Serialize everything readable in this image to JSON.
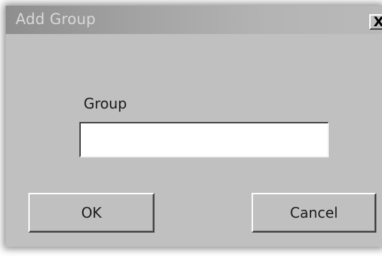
{
  "dialog": {
    "title": "Add Group",
    "close_glyph": "X",
    "field_label": "Group",
    "field_value": "",
    "ok_label": "OK",
    "cancel_label": "Cancel"
  },
  "colors": {
    "dialog_face": "#c0c0c0",
    "titlebar_start": "#8e8e8e",
    "titlebar_end": "#b9b9b9",
    "title_text": "#d9d9d9"
  },
  "icons": {
    "close": "close-icon"
  }
}
